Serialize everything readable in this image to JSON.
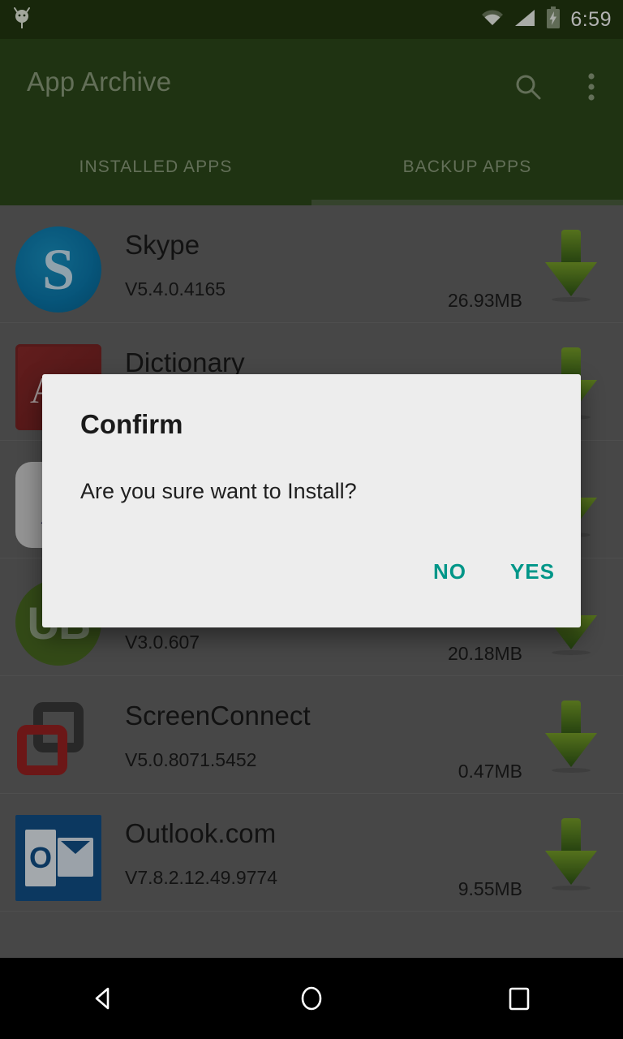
{
  "status_bar": {
    "time": "6:59",
    "icons": [
      "android-robot-icon",
      "wifi-icon",
      "cell-signal-icon",
      "battery-charging-icon"
    ]
  },
  "app_bar": {
    "title": "App Archive",
    "search_icon": "search-icon",
    "overflow_icon": "overflow-menu-icon"
  },
  "tabs": {
    "items": [
      {
        "label": "INSTALLED APPS",
        "selected": false
      },
      {
        "label": "BACKUP APPS",
        "selected": true
      }
    ]
  },
  "list": {
    "rows": [
      {
        "name": "Skype",
        "version": "V5.4.0.4165",
        "size": "26.93MB",
        "icon": "skype-icon",
        "action_icon": "download-arrow-icon"
      },
      {
        "name": "Dictionary",
        "version": "",
        "size": "",
        "icon": "dictionary-icon",
        "action_icon": "download-arrow-icon"
      },
      {
        "name": "",
        "version": "",
        "size": "",
        "icon": "x-app-icon",
        "action_icon": "download-arrow-icon"
      },
      {
        "name": "",
        "version": "V3.0.607",
        "size": "20.18MB",
        "icon": "ub-app-icon",
        "action_icon": "download-arrow-icon"
      },
      {
        "name": "ScreenConnect",
        "version": "V5.0.8071.5452",
        "size": "0.47MB",
        "icon": "screenconnect-icon",
        "action_icon": "download-arrow-icon"
      },
      {
        "name": "Outlook.com",
        "version": "V7.8.2.12.49.9774",
        "size": "9.55MB",
        "icon": "outlook-icon",
        "action_icon": "download-arrow-icon"
      }
    ]
  },
  "dialog": {
    "title": "Confirm",
    "message": "Are you sure want to Install?",
    "no_label": "NO",
    "yes_label": "YES",
    "accent_color": "#009688"
  },
  "nav_bar": {
    "back_icon": "back-triangle-icon",
    "home_icon": "home-circle-icon",
    "recents_icon": "recents-square-icon"
  },
  "colors": {
    "status_bar": "#233811",
    "app_bar": "#2d4a1b",
    "tab_indicator": "#4d6140",
    "list_background": "#666666",
    "dialog_background": "#ededed",
    "accent": "#009688"
  }
}
